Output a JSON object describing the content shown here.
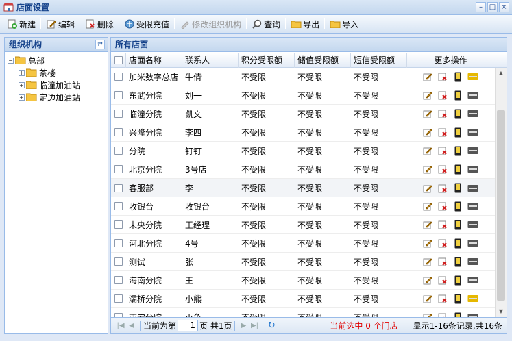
{
  "window": {
    "title": "店面设置",
    "min": "–",
    "max": "□",
    "close": "×"
  },
  "toolbar": {
    "new": "新建",
    "edit": "编辑",
    "delete": "删除",
    "recharge": "受限充值",
    "modify_org": "修改组织机构",
    "query": "查询",
    "export": "导出",
    "import": "导入"
  },
  "left": {
    "title": "组织机构",
    "root": "总部",
    "children": [
      "茶楼",
      "临潼加油站",
      "定边加油站"
    ]
  },
  "grid": {
    "title": "所有店面",
    "columns": [
      "店面名称",
      "联系人",
      "积分受限额",
      "储值受限额",
      "短信受限额",
      "更多操作"
    ],
    "rows": [
      {
        "name": "加米数字总店",
        "contact": "牛倩",
        "points": "不受限",
        "stored": "不受限",
        "sms": "不受限"
      },
      {
        "name": "东武分院",
        "contact": "刘一",
        "points": "不受限",
        "stored": "不受限",
        "sms": "不受限"
      },
      {
        "name": "临潼分院",
        "contact": "凯文",
        "points": "不受限",
        "stored": "不受限",
        "sms": "不受限"
      },
      {
        "name": "兴隆分院",
        "contact": "李四",
        "points": "不受限",
        "stored": "不受限",
        "sms": "不受限"
      },
      {
        "name": "分院",
        "contact": "钉钉",
        "points": "不受限",
        "stored": "不受限",
        "sms": "不受限"
      },
      {
        "name": "北京分院",
        "contact": "3号店",
        "points": "不受限",
        "stored": "不受限",
        "sms": "不受限"
      },
      {
        "name": "客服部",
        "contact": "李",
        "points": "不受限",
        "stored": "不受限",
        "sms": "不受限"
      },
      {
        "name": "收银台",
        "contact": "收银台",
        "points": "不受限",
        "stored": "不受限",
        "sms": "不受限"
      },
      {
        "name": "未央分院",
        "contact": "王经理",
        "points": "不受限",
        "stored": "不受限",
        "sms": "不受限"
      },
      {
        "name": "河北分院",
        "contact": "4号",
        "points": "不受限",
        "stored": "不受限",
        "sms": "不受限"
      },
      {
        "name": "测试",
        "contact": "张",
        "points": "不受限",
        "stored": "不受限",
        "sms": "不受限"
      },
      {
        "name": "海南分院",
        "contact": "王",
        "points": "不受限",
        "stored": "不受限",
        "sms": "不受限"
      },
      {
        "name": "灞桥分院",
        "contact": "小熊",
        "points": "不受限",
        "stored": "不受限",
        "sms": "不受限"
      },
      {
        "name": "西安分院",
        "contact": "小鱼",
        "points": "不受限",
        "stored": "不受限",
        "sms": "不受限"
      }
    ]
  },
  "pager": {
    "before": "当前为第",
    "page": "1",
    "after": "页 共1页",
    "selected": "当前选中 0 个门店",
    "records": "显示1-16条记录,共16条"
  },
  "colors": {
    "accent": "#15428b",
    "border": "#99bbe8",
    "selected_text": "#e00000"
  }
}
